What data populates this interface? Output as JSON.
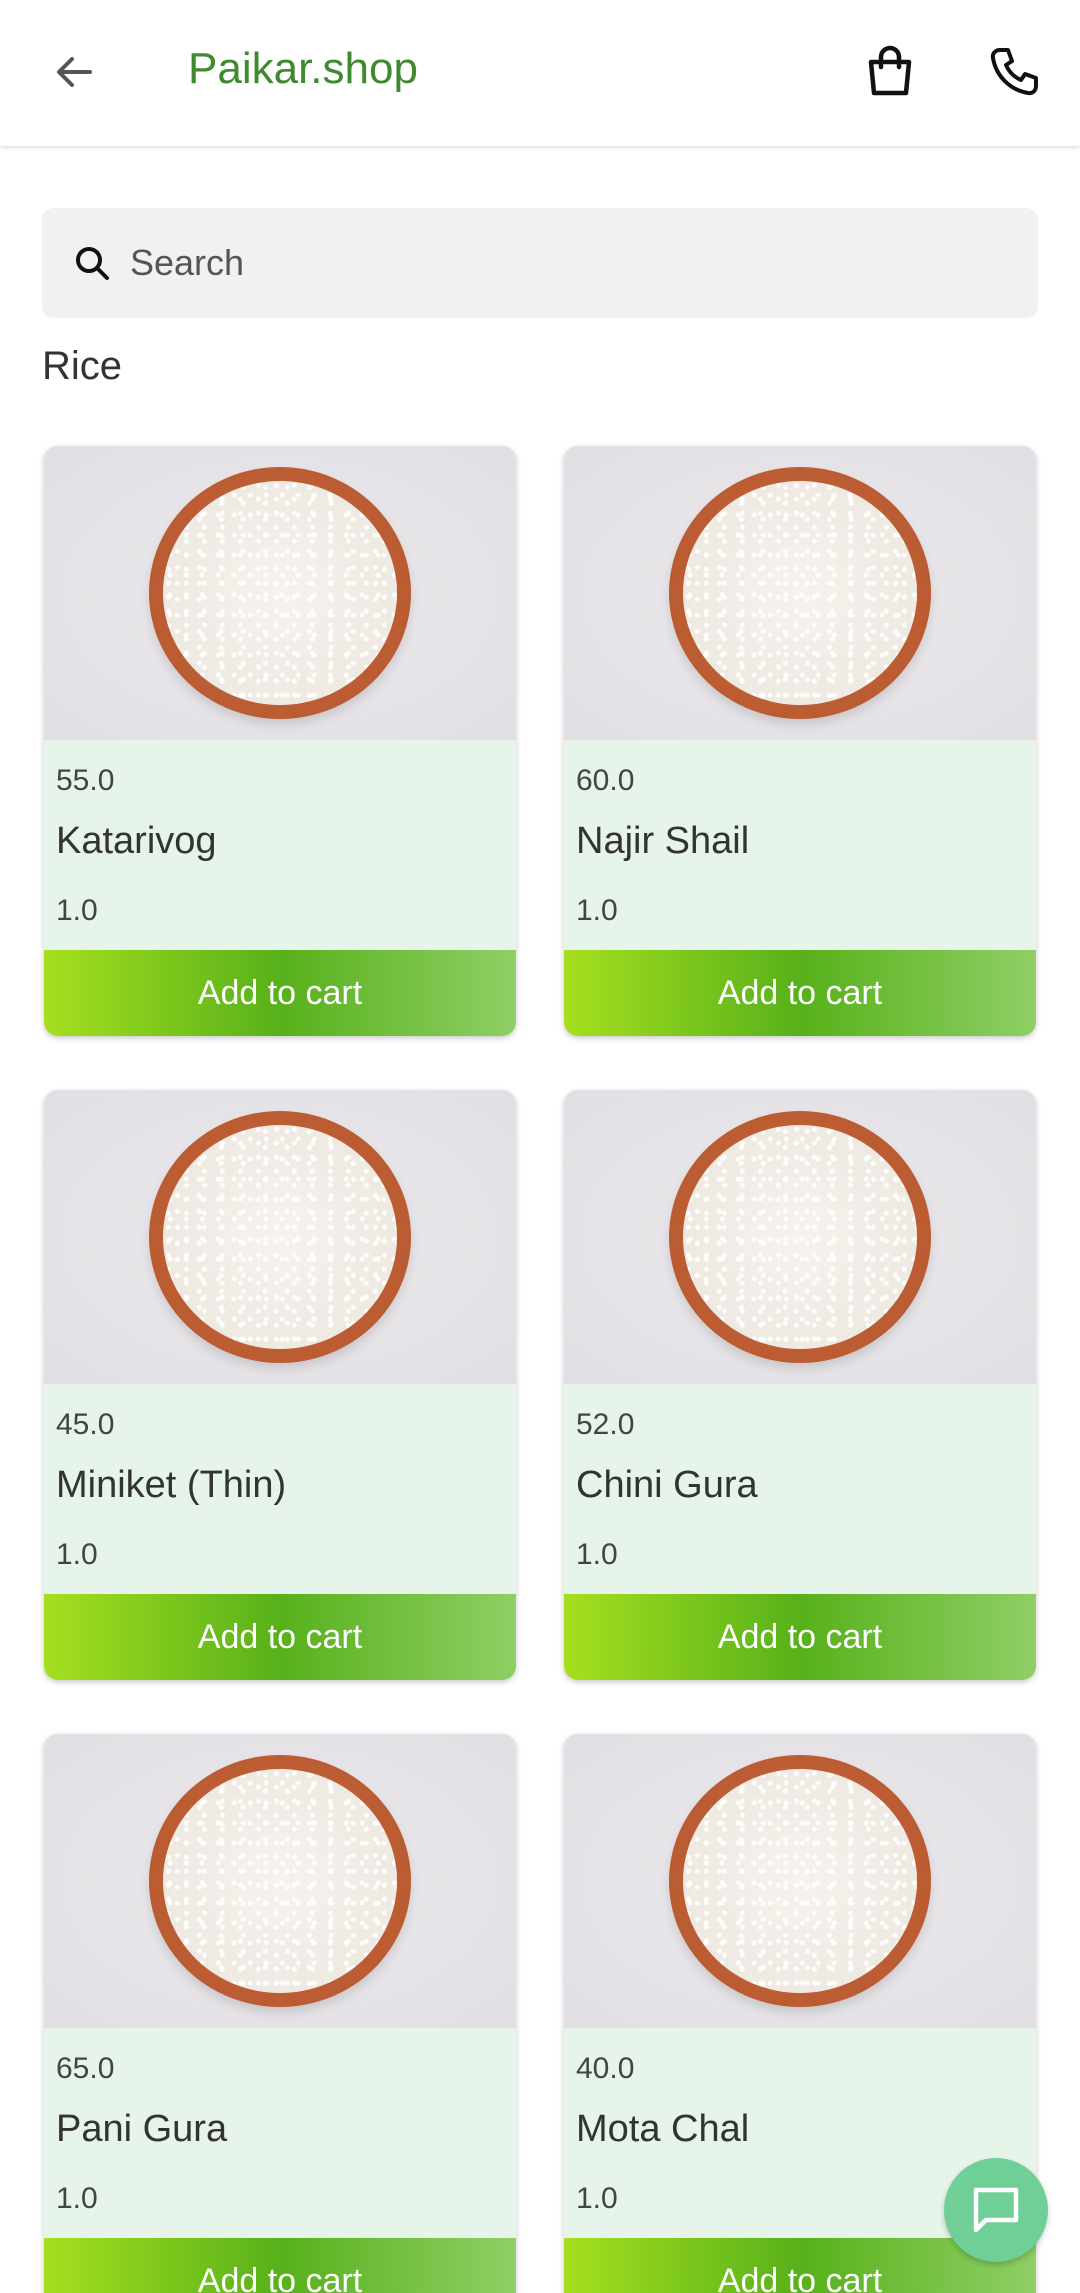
{
  "appbar": {
    "title": "Paikar.shop",
    "back_icon": "arrow-left-icon",
    "cart_icon": "shopping-bag-icon",
    "call_icon": "phone-icon",
    "title_color": "#3f8a2f"
  },
  "search": {
    "placeholder": "Search",
    "icon": "search-icon"
  },
  "category": {
    "title": "Rice"
  },
  "products": [
    {
      "price": "55.0",
      "name": "Katarivog",
      "qty": "1.0",
      "cta": "Add to cart"
    },
    {
      "price": "60.0",
      "name": "Najir Shail",
      "qty": "1.0",
      "cta": "Add to cart"
    },
    {
      "price": "45.0",
      "name": "Miniket (Thin)",
      "qty": "1.0",
      "cta": "Add to cart"
    },
    {
      "price": "52.0",
      "name": "Chini Gura",
      "qty": "1.0",
      "cta": "Add to cart"
    },
    {
      "price": "65.0",
      "name": "Pani Gura",
      "qty": "1.0",
      "cta": "Add to cart"
    },
    {
      "price": "40.0",
      "name": "Mota Chal",
      "qty": "1.0",
      "cta": "Add to cart"
    }
  ],
  "fab": {
    "icon": "chat-bubble-icon",
    "color": "#6fcf96"
  },
  "colors": {
    "card_bg": "#e6f4e9",
    "cta_gradient_start": "#a6df1f",
    "cta_gradient_mid": "#57b11a"
  }
}
